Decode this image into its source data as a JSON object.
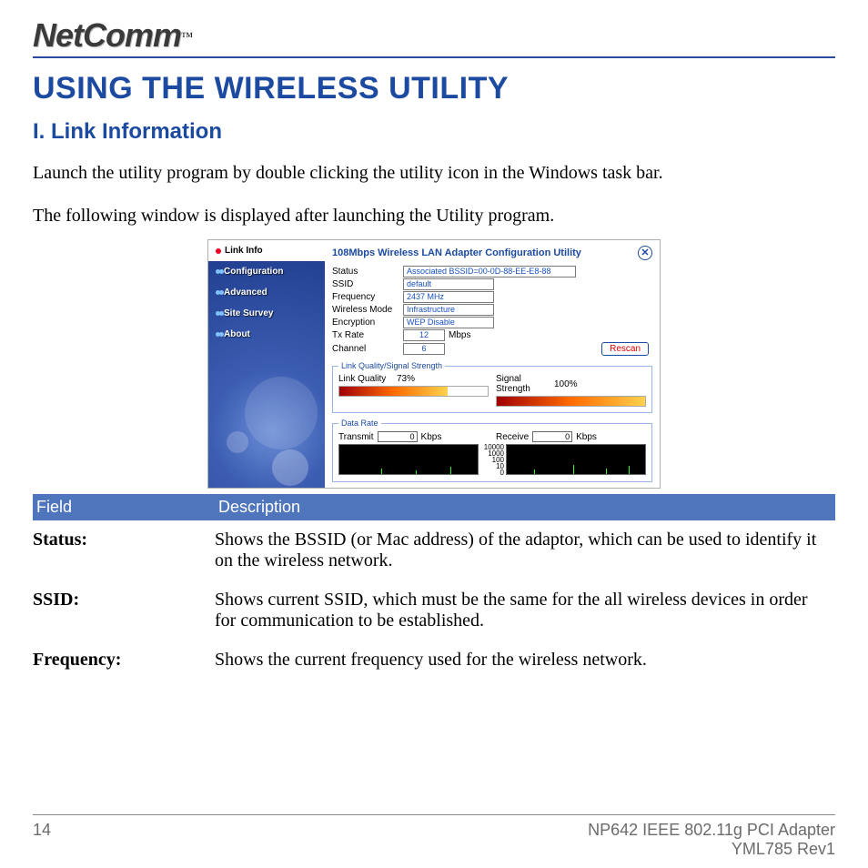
{
  "brand": "NetComm",
  "tm": "™",
  "title": "USING THE WIRELESS UTILITY",
  "section": "I. Link Information",
  "para1": "Launch the utility program by double clicking the utility icon in the Windows task bar.",
  "para2": "The following window is displayed after launching the Utility program.",
  "app": {
    "title": "108Mbps Wireless LAN Adapter Configuration Utility",
    "nav": {
      "link_info": "Link Info",
      "configuration": "Configuration",
      "advanced": "Advanced",
      "site_survey": "Site Survey",
      "about": "About"
    },
    "fields": {
      "status_label": "Status",
      "status_value": "Associated BSSID=00-0D-88-EE-E8-88",
      "ssid_label": "SSID",
      "ssid_value": "default",
      "frequency_label": "Frequency",
      "frequency_value": "2437 MHz",
      "wireless_mode_label": "Wireless Mode",
      "wireless_mode_value": "Infrastructure",
      "encryption_label": "Encryption",
      "encryption_value": "WEP Disable",
      "txrate_label": "Tx Rate",
      "txrate_value": "12",
      "txrate_unit": "Mbps",
      "channel_label": "Channel",
      "channel_value": "6",
      "rescan": "Rescan"
    },
    "quality": {
      "group": "Link Quality/Signal Strength",
      "lq_label": "Link Quality",
      "lq_pct": "73%",
      "ss_label": "Signal Strength",
      "ss_pct": "100%"
    },
    "datarate": {
      "group": "Data Rate",
      "tx_label": "Transmit",
      "tx_val": "0",
      "rx_label": "Receive",
      "rx_val": "0",
      "unit": "Kbps",
      "y4": "10000",
      "y3": "1000",
      "y2": "100",
      "y1": "10",
      "y0": "0"
    }
  },
  "table": {
    "h1": "Field",
    "h2": "Description",
    "rows": [
      {
        "f": "Status:",
        "d": "Shows the BSSID (or Mac address) of the adaptor, which can be used to identify it on the wireless network."
      },
      {
        "f": "SSID:",
        "d": "Shows current SSID, which must be the same for the all wireless devices in order for communication to be established."
      },
      {
        "f": "Frequency:",
        "d": "Shows the current frequency used for the wireless network."
      }
    ]
  },
  "footer": {
    "page": "14",
    "prod": "NP642 IEEE 802.11g PCI Adapter",
    "rev": "YML785 Rev1"
  }
}
